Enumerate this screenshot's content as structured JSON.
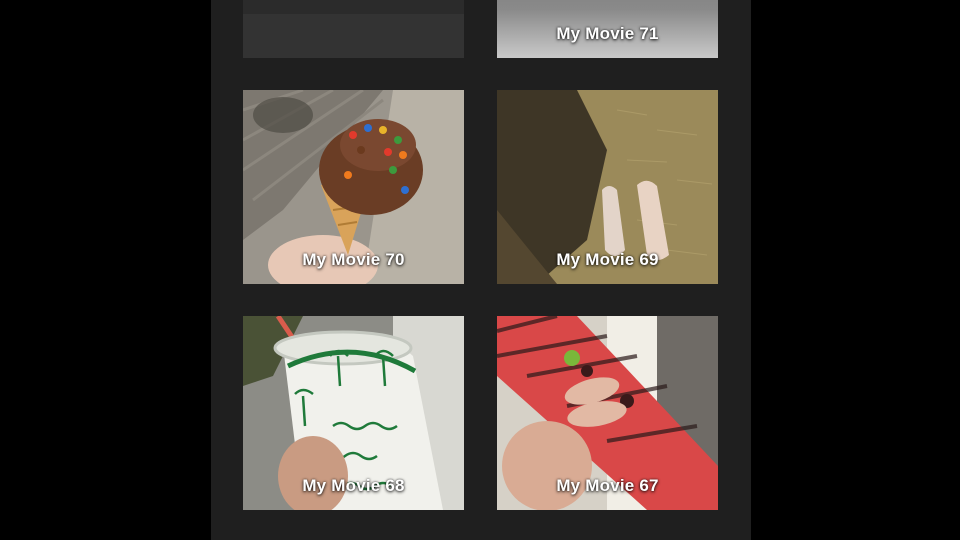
{
  "movies": [
    {
      "label": ""
    },
    {
      "label": "My Movie 71"
    },
    {
      "label": "My Movie 70"
    },
    {
      "label": "My Movie 69"
    },
    {
      "label": "My Movie 68"
    },
    {
      "label": "My Movie 67"
    }
  ],
  "colors": {
    "background": "#000000",
    "grid_background": "#1f1f1f",
    "label_text": "#ffffff"
  }
}
